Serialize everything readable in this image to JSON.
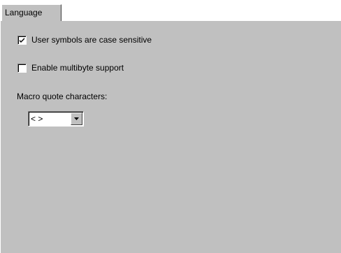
{
  "tab": {
    "label": "Language"
  },
  "options": {
    "case_sensitive": {
      "label": "User symbols are case sensitive",
      "checked": true
    },
    "multibyte": {
      "label": "Enable multibyte support",
      "checked": false
    }
  },
  "macro_quote": {
    "label": "Macro quote characters:",
    "value": "< >",
    "dropdown_icon": "chevron-down-icon"
  },
  "colors": {
    "panel_bg": "#c0c0c0",
    "field_bg": "#ffffff"
  }
}
